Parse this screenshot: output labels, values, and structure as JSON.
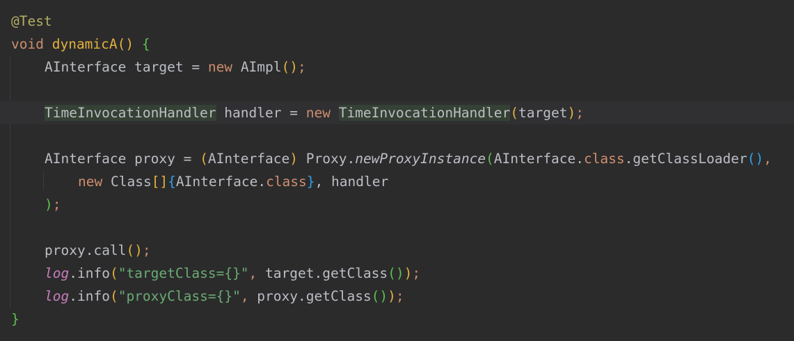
{
  "code": {
    "line1": {
      "annotation": "@Test"
    },
    "line2": {
      "kw_void": "void",
      "method_name": "dynamicA",
      "parens": "()",
      "brace_open": "{"
    },
    "line3": {
      "type": "AInterface",
      "var": " target ",
      "eq": "=",
      "kw_new": "new",
      "ctor": "AImpl",
      "paren_open": "(",
      "paren_close": ")",
      "semi": ";"
    },
    "line5": {
      "type": "TimeInvocationHandler",
      "var": " handler ",
      "eq": "=",
      "kw_new": "new",
      "ctor": "TimeInvocationHandler",
      "paren_open": "(",
      "arg": "target",
      "paren_close": ")",
      "semi": ";"
    },
    "line7": {
      "type": "AInterface",
      "var": " proxy ",
      "eq": "=",
      "cast_open": "(",
      "cast_type": "AInterface",
      "cast_close": ")",
      "proxy": "Proxy",
      "dot": ".",
      "method": "newProxyInstance",
      "call_open": "(",
      "arg_type": "AInterface",
      "dot2": ".",
      "kw_class": "class",
      "dot3": ".",
      "loader": "getClassLoader",
      "loader_parens": "()",
      "comma": ","
    },
    "line8": {
      "kw_new": "new",
      "class_type": "Class",
      "brackets": "[]",
      "brace_open": "{",
      "arg_type": "AInterface",
      "dot": ".",
      "kw_class": "class",
      "brace_close": "}",
      "rest": ", handler"
    },
    "line9": {
      "call_close": ")",
      "semi": ";"
    },
    "line11": {
      "obj": "proxy",
      "dot": ".",
      "method": "call",
      "parens": "()",
      "semi": ";"
    },
    "line12": {
      "field": "log",
      "dot": ".",
      "method": "info",
      "paren_open": "(",
      "str": "\"targetClass={}\"",
      "comma": ", ",
      "obj": "target",
      "dot2": ".",
      "getclass": "getClass",
      "parens": "()",
      "paren_close": ")",
      "semi": ";"
    },
    "line13": {
      "field": "log",
      "dot": ".",
      "method": "info",
      "paren_open": "(",
      "str": "\"proxyClass={}\"",
      "comma": ", ",
      "obj": "proxy",
      "dot2": ".",
      "getclass": "getClass",
      "parens": "()",
      "paren_close": ")",
      "semi": ";"
    },
    "line14": {
      "brace_close": "}"
    }
  },
  "colors": {
    "background": "#2b2b2c",
    "current_line": "#303033",
    "identifier_highlight": "#344134",
    "keyword": "#cf8e6d",
    "annotation": "#b3ae60",
    "string": "#6aab73",
    "method_declaration": "#e3b23c",
    "static_field": "#c77dbb"
  }
}
